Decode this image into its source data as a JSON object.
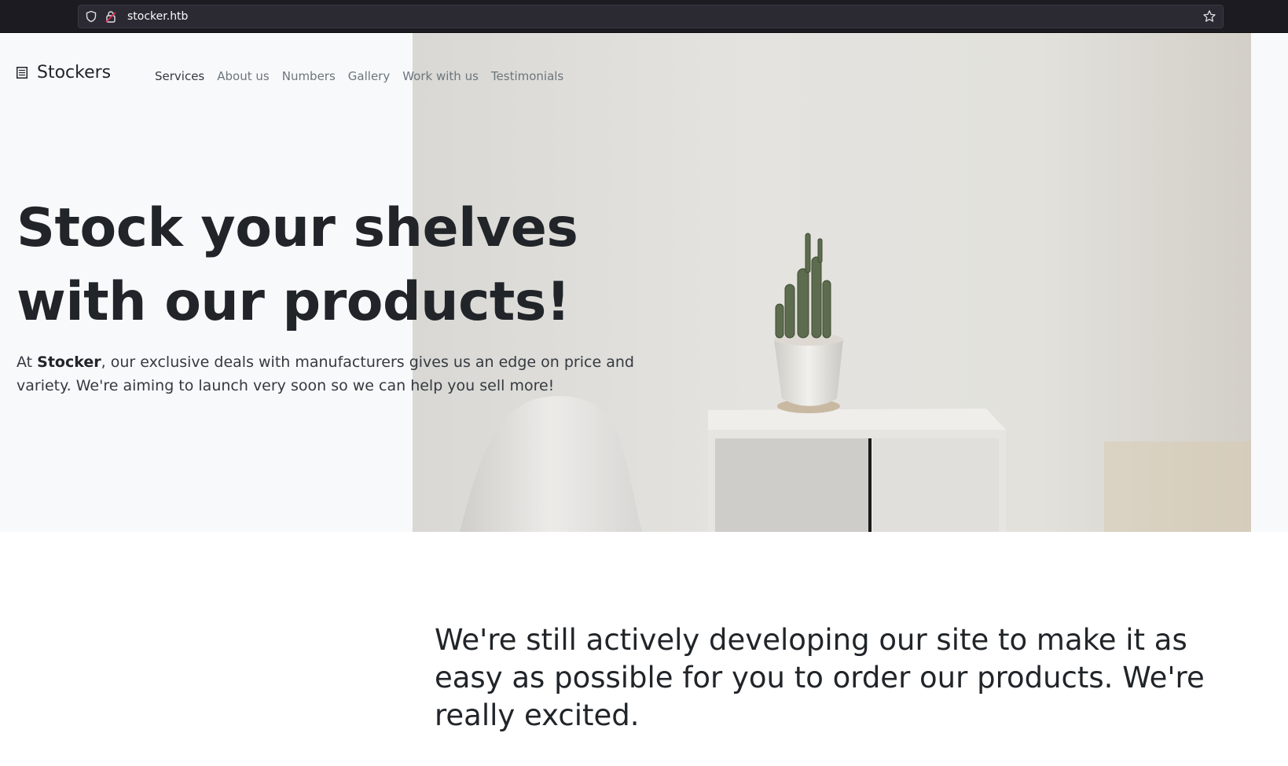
{
  "browser": {
    "url": "stocker.htb",
    "icons": [
      "shield-icon",
      "lock-icon",
      "bookmark-star-icon"
    ]
  },
  "navbar": {
    "brand": "Stockers",
    "brand_icon": "list-icon",
    "links": [
      {
        "label": "Services"
      },
      {
        "label": "About us"
      },
      {
        "label": "Numbers"
      },
      {
        "label": "Gallery"
      },
      {
        "label": "Work with us"
      },
      {
        "label": "Testimonials"
      }
    ]
  },
  "hero": {
    "title_line1": "Stock your shelves",
    "title_line2": "with our products!",
    "lead_prefix": "At ",
    "lead_brand": "Stocker",
    "lead_rest": ", our exclusive deals with manufacturers gives us an edge on price and variety. We're aiming to launch very soon so we can help you sell more!",
    "image": "room-with-chair-cabinet-and-cactus"
  },
  "intro": {
    "text": "We're still actively developing our site to make it as easy as possible for you to order our products. We're really excited."
  },
  "colors": {
    "hero_bg": "#f8f9fa",
    "heading": "#212529",
    "nav_link": "#6c757d",
    "chrome_bg": "#1c1b22"
  }
}
